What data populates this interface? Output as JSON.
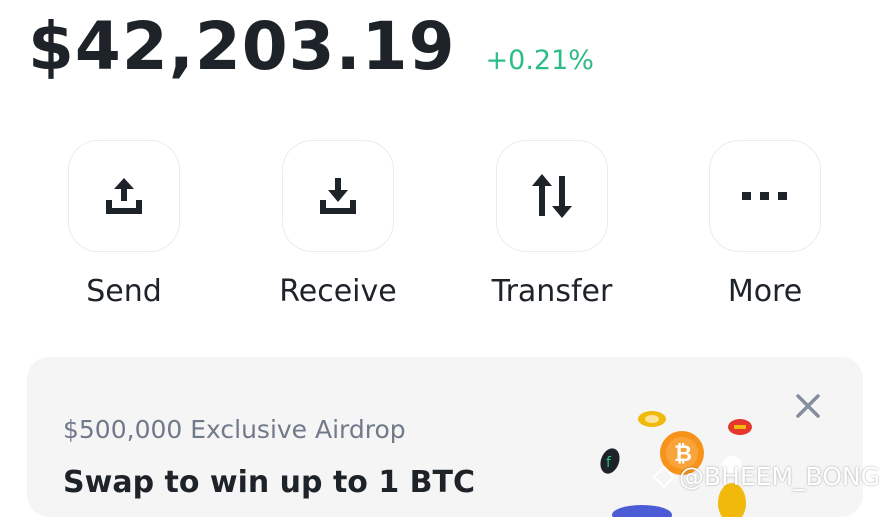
{
  "balance": {
    "amount": "$42,203.19",
    "change": "+0.21%"
  },
  "actions": [
    {
      "label": "Send",
      "icon": "upload-icon"
    },
    {
      "label": "Receive",
      "icon": "download-icon"
    },
    {
      "label": "Transfer",
      "icon": "transfer-arrows-icon"
    },
    {
      "label": "More",
      "icon": "more-dots-icon"
    }
  ],
  "banner": {
    "subtitle": "$500,000 Exclusive Airdrop",
    "headline": "Swap to win up to 1 BTC",
    "close_icon": "close-icon"
  },
  "watermark": "@BHEEM_BONG",
  "colors": {
    "positive": "#2ebd85",
    "text": "#1e2329",
    "muted": "#707a8a",
    "banner_bg": "#f5f5f5"
  }
}
